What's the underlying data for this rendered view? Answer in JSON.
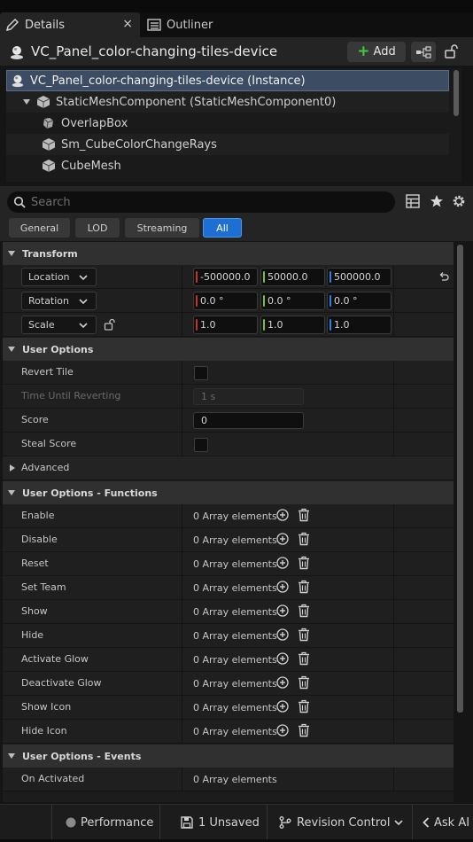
{
  "tabs": [
    {
      "label": "Details",
      "close": "×"
    },
    {
      "label": "Outliner"
    }
  ],
  "header": {
    "actor_name": "VC_Panel_color-changing-tiles-device",
    "add_label": "Add"
  },
  "components": [
    {
      "label": "VC_Panel_color-changing-tiles-device (Instance)",
      "indent": 0,
      "icon": "actor-icon",
      "selected": true
    },
    {
      "label": "StaticMeshComponent (StaticMeshComponent0)",
      "indent": 1,
      "icon": "static-mesh-icon",
      "expanded": true
    },
    {
      "label": "OverlapBox",
      "indent": 2,
      "icon": "overlap-box-icon"
    },
    {
      "label": "Sm_CubeColorChangeRays",
      "indent": 2,
      "icon": "static-mesh-icon"
    },
    {
      "label": "CubeMesh",
      "indent": 2,
      "icon": "static-mesh-icon"
    }
  ],
  "search": {
    "placeholder": "Search"
  },
  "filters": {
    "items": [
      "General",
      "LOD",
      "Streaming",
      "All"
    ],
    "active": "All"
  },
  "transform": {
    "title": "Transform",
    "location": {
      "label": "Location",
      "x": "-500000.0",
      "y": "50000.0",
      "z": "500000.0"
    },
    "rotation": {
      "label": "Rotation",
      "x": "0.0 °",
      "y": "0.0 °",
      "z": "0.0 °"
    },
    "scale": {
      "label": "Scale",
      "x": "1.0",
      "y": "1.0",
      "z": "1.0"
    }
  },
  "user_options": {
    "title": "User Options",
    "revert_tile": {
      "label": "Revert Tile",
      "checked": false
    },
    "time_until_reverting": {
      "label": "Time Until Reverting",
      "value": "1 s",
      "disabled": true
    },
    "score": {
      "label": "Score",
      "value": "0"
    },
    "steal_score": {
      "label": "Steal Score",
      "checked": false
    },
    "advanced": "Advanced"
  },
  "functions": {
    "title": "User Options - Functions",
    "items": [
      {
        "label": "Enable",
        "value": "0 Array elements"
      },
      {
        "label": "Disable",
        "value": "0 Array elements"
      },
      {
        "label": "Reset",
        "value": "0 Array elements"
      },
      {
        "label": "Set Team",
        "value": "0 Array elements"
      },
      {
        "label": "Show",
        "value": "0 Array elements"
      },
      {
        "label": "Hide",
        "value": "0 Array elements"
      },
      {
        "label": "Activate Glow",
        "value": "0 Array elements"
      },
      {
        "label": "Deactivate Glow",
        "value": "0 Array elements"
      },
      {
        "label": "Show Icon",
        "value": "0 Array elements"
      },
      {
        "label": "Hide Icon",
        "value": "0 Array elements"
      }
    ]
  },
  "events": {
    "title": "User Options - Events",
    "items": [
      {
        "label": "On Activated",
        "value": "0 Array elements"
      }
    ]
  },
  "statusbar": {
    "performance": "Performance",
    "unsaved": "1 Unsaved",
    "revision": "Revision Control",
    "ask_ai": "Ask AI"
  },
  "colors": {
    "accent": "#1d6fd3",
    "selection": "#3c4c63",
    "x_axis": "#c8332b",
    "y_axis": "#7fbf2a",
    "z_axis": "#2f7fe6",
    "add_green": "#3ecb3e"
  }
}
